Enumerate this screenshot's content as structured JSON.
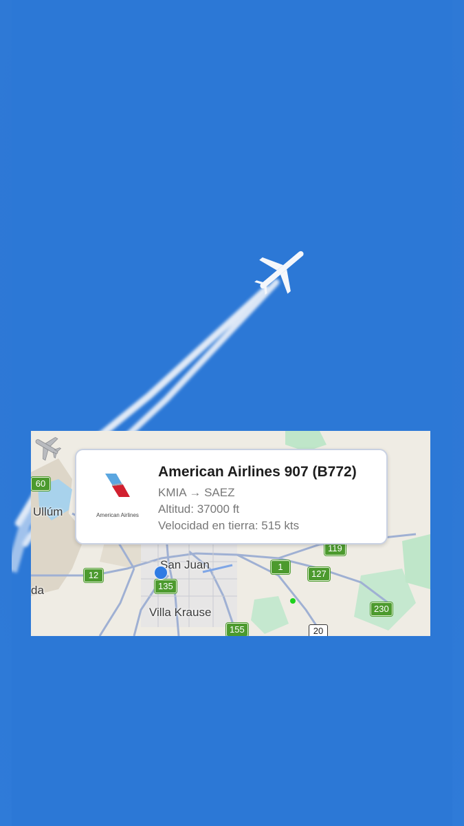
{
  "flight": {
    "title": "American Airlines 907 (B772)",
    "route": "KMIA → SAEZ",
    "altitude": "Altitud: 37000 ft",
    "ground_speed": "Velocidad en tierra: 515 kts",
    "logo_caption": "American Airlines"
  },
  "map": {
    "places": {
      "ullum": "Ullúm",
      "san_juan": "San Juan",
      "villa_krause": "Villa Krause",
      "partial_left": "da"
    },
    "routes": {
      "r60": "60",
      "r12": "12",
      "r135": "135",
      "r119": "119",
      "r1": "1",
      "r127": "127",
      "r230": "230",
      "r155": "155",
      "r20": "20"
    }
  },
  "icons": {
    "airline_logo": "american-airlines-logo",
    "aircraft": "airplane-icon",
    "location": "my-location-dot"
  },
  "colors": {
    "sky": "#2f7ad6",
    "route_shield": "#4c9a2e",
    "popup_border": "#c9d1e2"
  }
}
